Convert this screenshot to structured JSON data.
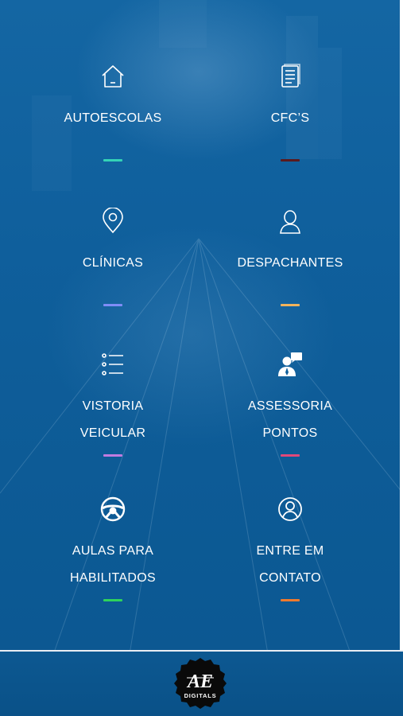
{
  "menu": [
    {
      "id": "autoescolas",
      "lines": [
        "AUTOESCOLAS"
      ],
      "icon": "home-icon",
      "accent": "#34d3b6"
    },
    {
      "id": "cfcs",
      "lines": [
        "CFC’S"
      ],
      "icon": "document-icon",
      "accent": "#5a1a1e"
    },
    {
      "id": "clinicas",
      "lines": [
        "CLÍNICAS"
      ],
      "icon": "location-pin-icon",
      "accent": "#7f8df7"
    },
    {
      "id": "despachantes",
      "lines": [
        "DESPACHANTES"
      ],
      "icon": "user-icon",
      "accent": "#f2b35c"
    },
    {
      "id": "vistoria",
      "lines": [
        "VISTORIA",
        "VEICULAR"
      ],
      "icon": "list-icon",
      "accent": "#c07be0"
    },
    {
      "id": "assessoria",
      "lines": [
        "ASSESSORIA",
        "PONTOS"
      ],
      "icon": "presenter-icon",
      "accent": "#e0487a"
    },
    {
      "id": "aulas",
      "lines": [
        "AULAS PARA",
        "HABILITADOS"
      ],
      "icon": "steering-wheel-icon",
      "accent": "#2fd35b"
    },
    {
      "id": "contato",
      "lines": [
        "ENTRE EM",
        "CONTATO"
      ],
      "icon": "user-circle-icon",
      "accent": "#ef7a2e"
    }
  ],
  "footer": {
    "logo_mark": "AE",
    "logo_text": "DIGITALS",
    "logo_icon": "ae-digitals-logo-icon"
  }
}
